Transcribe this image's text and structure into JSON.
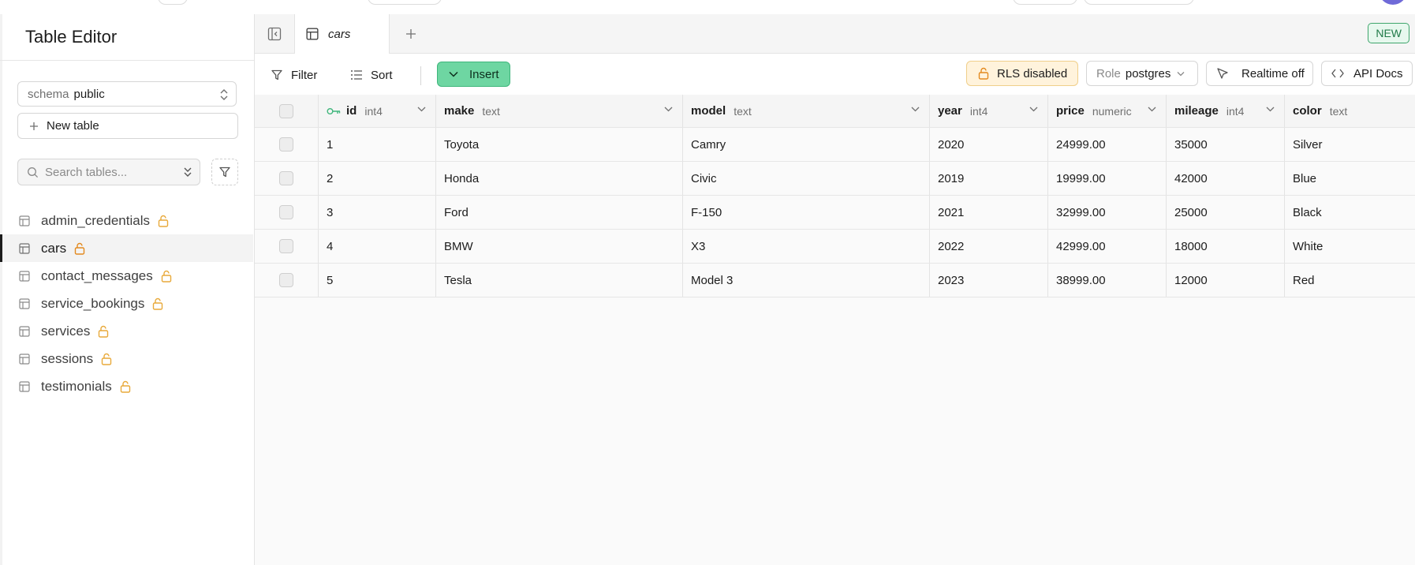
{
  "sidebar": {
    "title": "Table Editor",
    "schema": {
      "label": "schema",
      "value": "public"
    },
    "new_table_label": "New table",
    "search_placeholder": "Search tables...",
    "tables": [
      {
        "name": "admin_credentials",
        "active": false
      },
      {
        "name": "cars",
        "active": true
      },
      {
        "name": "contact_messages",
        "active": false
      },
      {
        "name": "service_bookings",
        "active": false
      },
      {
        "name": "services",
        "active": false
      },
      {
        "name": "sessions",
        "active": false
      },
      {
        "name": "testimonials",
        "active": false
      }
    ]
  },
  "tabs": {
    "active_tab": "cars",
    "new_badge": "NEW"
  },
  "toolbar": {
    "filter_label": "Filter",
    "sort_label": "Sort",
    "insert_label": "Insert",
    "rls_label": "RLS disabled",
    "role_label": "Role",
    "role_value": "postgres",
    "realtime_label": "Realtime off",
    "api_docs_label": "API Docs"
  },
  "grid": {
    "columns": [
      {
        "name": "id",
        "type": "int4",
        "primary_key": true
      },
      {
        "name": "make",
        "type": "text"
      },
      {
        "name": "model",
        "type": "text"
      },
      {
        "name": "year",
        "type": "int4"
      },
      {
        "name": "price",
        "type": "numeric"
      },
      {
        "name": "mileage",
        "type": "int4"
      },
      {
        "name": "color",
        "type": "text"
      }
    ],
    "rows": [
      [
        "1",
        "Toyota",
        "Camry",
        "2020",
        "24999.00",
        "35000",
        "Silver"
      ],
      [
        "2",
        "Honda",
        "Civic",
        "2019",
        "19999.00",
        "42000",
        "Blue"
      ],
      [
        "3",
        "Ford",
        "F-150",
        "2021",
        "32999.00",
        "25000",
        "Black"
      ],
      [
        "4",
        "BMW",
        "X3",
        "2022",
        "42999.00",
        "18000",
        "White"
      ],
      [
        "5",
        "Tesla",
        "Model 3",
        "2023",
        "38999.00",
        "12000",
        "Red"
      ]
    ]
  },
  "colors": {
    "accent_green": "#6ed6a2",
    "rls_warning_bg": "#fff3dc",
    "lock_icon": "#e8a93a",
    "new_badge_green": "#1f7a48"
  }
}
